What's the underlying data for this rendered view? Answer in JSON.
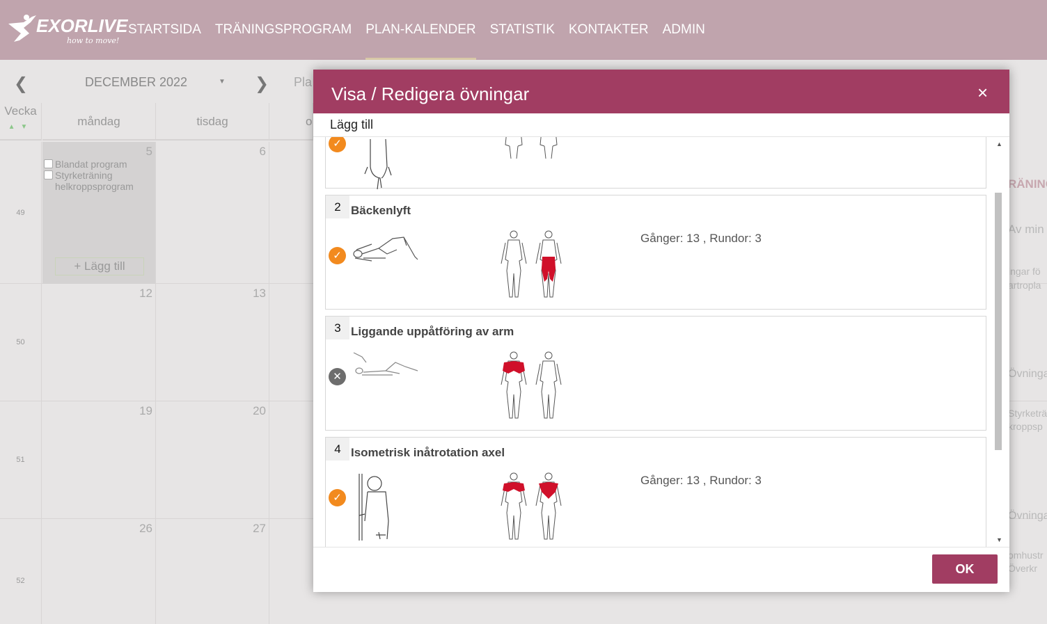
{
  "brand": {
    "name": "EXORLIVE",
    "tagline": "how to move!"
  },
  "nav": {
    "items": [
      {
        "label": "STARTSIDA",
        "active": false
      },
      {
        "label": "TRÄNINGSPROGRAM",
        "active": false
      },
      {
        "label": "PLAN-KALENDER",
        "active": true
      },
      {
        "label": "STATISTIK",
        "active": false
      },
      {
        "label": "KONTAKTER",
        "active": false
      },
      {
        "label": "ADMIN",
        "active": false
      }
    ]
  },
  "calendar": {
    "month": "DECEMBER 2022",
    "partial_label": "Pla",
    "week_header": "Vecka",
    "days": [
      "måndag",
      "tisdag",
      "o"
    ],
    "weeks": [
      {
        "num": "49",
        "dates": [
          "5",
          "6"
        ]
      },
      {
        "num": "50",
        "dates": [
          "12",
          "13"
        ]
      },
      {
        "num": "51",
        "dates": [
          "19",
          "20"
        ]
      },
      {
        "num": "52",
        "dates": [
          "26",
          "27"
        ]
      }
    ],
    "monday_programs": [
      "Blandat program",
      "Styrketräning helkroppsprogram"
    ],
    "add_label": "+ Lägg till"
  },
  "right_panel": {
    "title": "RÄNING",
    "lines": [
      "Av min",
      "ingar fö",
      "artropla",
      "Övninga",
      "Styrketrä",
      "kroppsp",
      "Övninga",
      "omhustr",
      "Överkr"
    ]
  },
  "dialog": {
    "title": "Visa / Redigera övningar",
    "close": "×",
    "add_label": "Lägg till",
    "ok_label": "OK",
    "exercises": [
      {
        "num": "2",
        "name": "Bäckenlyft",
        "status": "done",
        "dose": "Gånger: 13 , Rundor: 3",
        "muscles": "glutes-back"
      },
      {
        "num": "3",
        "name": "Liggande uppåtföring av arm",
        "status": "skipped",
        "dose": "",
        "muscles": "chest-front"
      },
      {
        "num": "4",
        "name": "Isometrisk inåtrotation axel",
        "status": "done",
        "dose": "Gånger: 13 , Rundor: 3",
        "muscles": "shoulders-both"
      }
    ]
  },
  "colors": {
    "brand": "#a13d62",
    "nav_bg": "#c0a4ad",
    "done": "#f28a1e",
    "skipped": "#6d6d6d",
    "muscle": "#d0102a"
  }
}
